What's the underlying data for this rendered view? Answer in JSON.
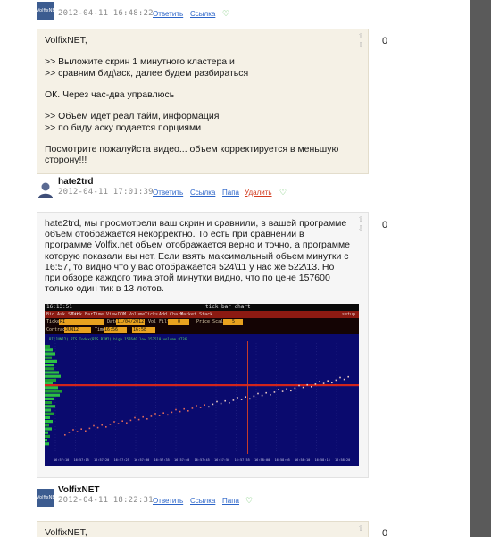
{
  "comments": [
    {
      "author": "",
      "avatar_text": "VolfixNET",
      "date": "2012-04-11 16:48:22",
      "actions": [
        "Ответить",
        "Ссылка"
      ]
    },
    {
      "text": "VolfixNET,\n\n>> Выложите скрин 1 минутного кластера и\n>> сравним бид\\аск, далее будем разбираться\n\nОК. Через час-два управлюсь\n\n>> Объем идет реал тайм, информация\n>> по биду аску подается порциями\n\nПосмотрите пожалуйста видео... объем корректируется в меньшую сторону!!!",
      "score": "0",
      "author": "hate2trd",
      "date": "2012-04-11 17:01:39",
      "actions": [
        "Ответить",
        "Ссылка",
        "Папа",
        "Удалить"
      ]
    },
    {
      "text": "hate2trd, мы просмотрели ваш скрин и сравнили, в вашей программе объем отображается некорректно. То есть при сравнении в программе Volfix.net объем отображается верно и точно, а программе которую показали вы нет. Если взять максимальный объем минутки с 16:57, то видно что у вас отображается 524\\11 у нас же 522\\13. Но при обзоре каждого тика этой минутки видно, что по цене 157600 только один тик в 13 лотов.",
      "score": "0",
      "author": "VolfixNET",
      "avatar_text": "VolfixNET",
      "date": "2012-04-11 18:22:31",
      "actions": [
        "Ответить",
        "Ссылка",
        "Папа"
      ]
    },
    {
      "text": "VolfixNET,",
      "score": "0"
    }
  ],
  "icons": {
    "vote_up": "arrow-up-icon",
    "vote_down": "arrow-down-icon",
    "like": "heart-icon"
  },
  "vote_up_glyph": "⇧",
  "vote_down_glyph": "⇩",
  "like_glyph": "♡",
  "trading_chart": {
    "clock": "16:13:51",
    "title": "tick bar chart",
    "menu": [
      "Bid Ask Stat",
      "Tick Bar",
      "Time View",
      "DOM Volume",
      "Ticks",
      "Add Chart",
      "Market Stack"
    ],
    "setup_label": "setup",
    "ticker_label": "Ticker",
    "ticker_value": "RI",
    "date_label": "Date",
    "date_value": "11/04/2012",
    "vol_filter_label": "Vol Filter",
    "vol_filter_value": "0",
    "price_scale_label": "Price Scale",
    "price_scale_value": "5",
    "contract_label": "Contract",
    "contract_value": "JUN12",
    "time_from": "16:56",
    "time_to": "16:58",
    "info_line": "RI(JUN12)   RTS Index(RTS RIM2)   high 157640   low 157510   volume 8736",
    "time_ticks": [
      "16:57:10",
      "16:57:15",
      "16:57:20",
      "16:57:25",
      "16:57:30",
      "16:57:35",
      "16:57:40",
      "16:57:45",
      "16:57:50",
      "16:57:55",
      "16:58:00",
      "16:58:05",
      "16:58:10",
      "16:58:15",
      "16:58:20"
    ]
  }
}
